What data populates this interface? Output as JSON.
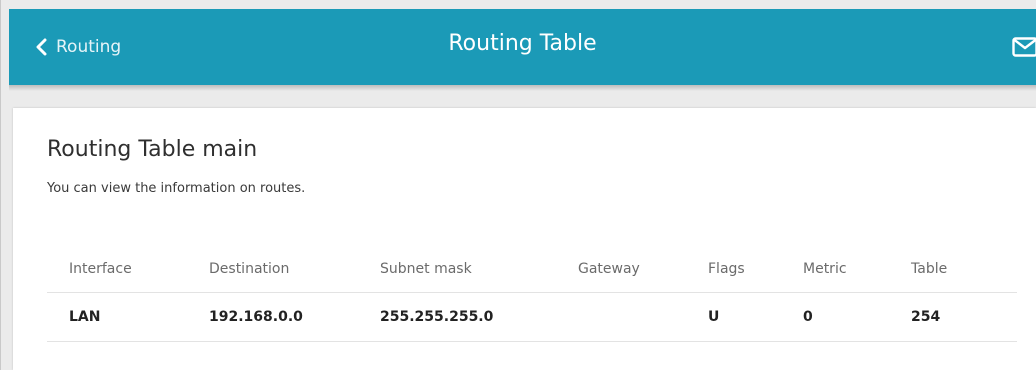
{
  "header": {
    "back_label": "Routing",
    "title": "Routing Table",
    "mail_icon": "envelope-icon",
    "back_icon": "chevron-left-icon",
    "accent_color": "#1b9ab7"
  },
  "card": {
    "title": "Routing Table main",
    "description": "You can view the information on routes."
  },
  "table": {
    "columns": [
      "Interface",
      "Destination",
      "Subnet mask",
      "Gateway",
      "Flags",
      "Metric",
      "Table"
    ],
    "rows": [
      [
        "LAN",
        "192.168.0.0",
        "255.255.255.0",
        "",
        "U",
        "0",
        "254"
      ]
    ]
  }
}
